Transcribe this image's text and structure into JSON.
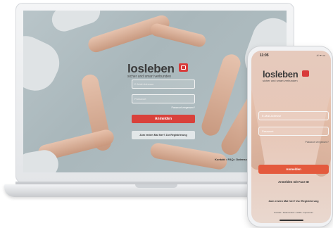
{
  "brand": {
    "name": "losleben",
    "tagline": "sicher und smart verbunden",
    "accent": "#d9413b"
  },
  "laptop": {
    "email_placeholder": "E-Mail-Adresse",
    "password_placeholder": "Passwort",
    "forgot_password": "Passwort vergessen?",
    "login_button": "Anmelden",
    "register_button": "Zum ersten Mal hier? Zur Registrierung",
    "footer": "Kontakt • FAQ • Datenschutz"
  },
  "phone": {
    "status_time": "11:05",
    "status_icons": ".ıl ᯤ ▭",
    "email_placeholder": "E-Mail-Adresse",
    "password_placeholder": "Passwort",
    "forgot_password": "Passwort vergessen?",
    "login_button": "Anmelden",
    "face_id": "Anmelden mit Face ID",
    "register": "Zum ersten Mal hier? Zur Registrierung",
    "footer": "Kontakt • Datenschutz • AGB • Impressum"
  }
}
